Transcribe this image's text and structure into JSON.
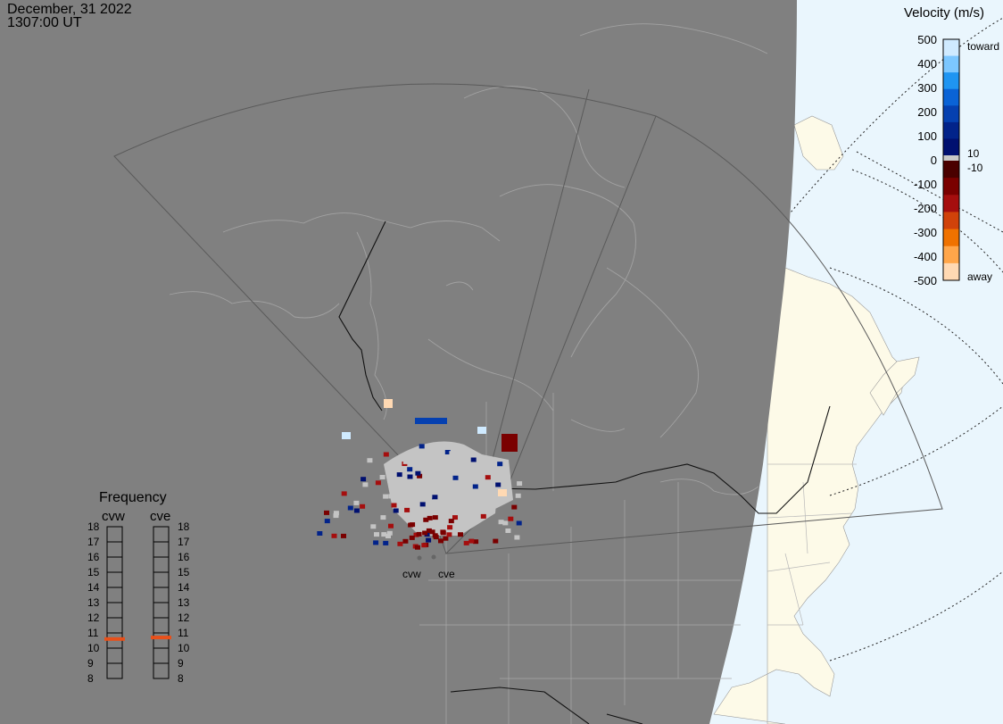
{
  "header": {
    "date": "December, 31 2022",
    "time": "1307:00 UT"
  },
  "velocity_legend": {
    "title": "Velocity (m/s)",
    "ticks": [
      "500",
      "400",
      "300",
      "200",
      "100",
      "0",
      "-100",
      "-200",
      "-300",
      "-400",
      "-500"
    ],
    "label_toward": "toward",
    "label_away": "away",
    "label_pos_threshold": "10",
    "label_neg_threshold": "-10",
    "colors_toward": [
      "#cfeaff",
      "#7cc7ff",
      "#1f95f2",
      "#0a63d6",
      "#0540b0",
      "#02238a",
      "#001070"
    ],
    "colors_away": [
      "#4a0000",
      "#7a0000",
      "#a50e0e",
      "#d0420a",
      "#ef7200",
      "#ffa64a",
      "#ffd9b3"
    ]
  },
  "frequency": {
    "title": "Frequency",
    "radars": [
      {
        "name": "cvw",
        "value": 10.6
      },
      {
        "name": "cve",
        "value": 10.7
      }
    ],
    "scale": [
      "18",
      "17",
      "16",
      "15",
      "14",
      "13",
      "12",
      "11",
      "10",
      "9",
      "8"
    ],
    "marker_color": "#e8501a"
  },
  "stations": [
    {
      "name": "cvw"
    },
    {
      "name": "cve"
    }
  ],
  "map_colors": {
    "night": "#808080",
    "day_land": "#fdfae8",
    "day_ocean": "#eaf6fd",
    "scatter_ground": "#c4c4c4"
  }
}
